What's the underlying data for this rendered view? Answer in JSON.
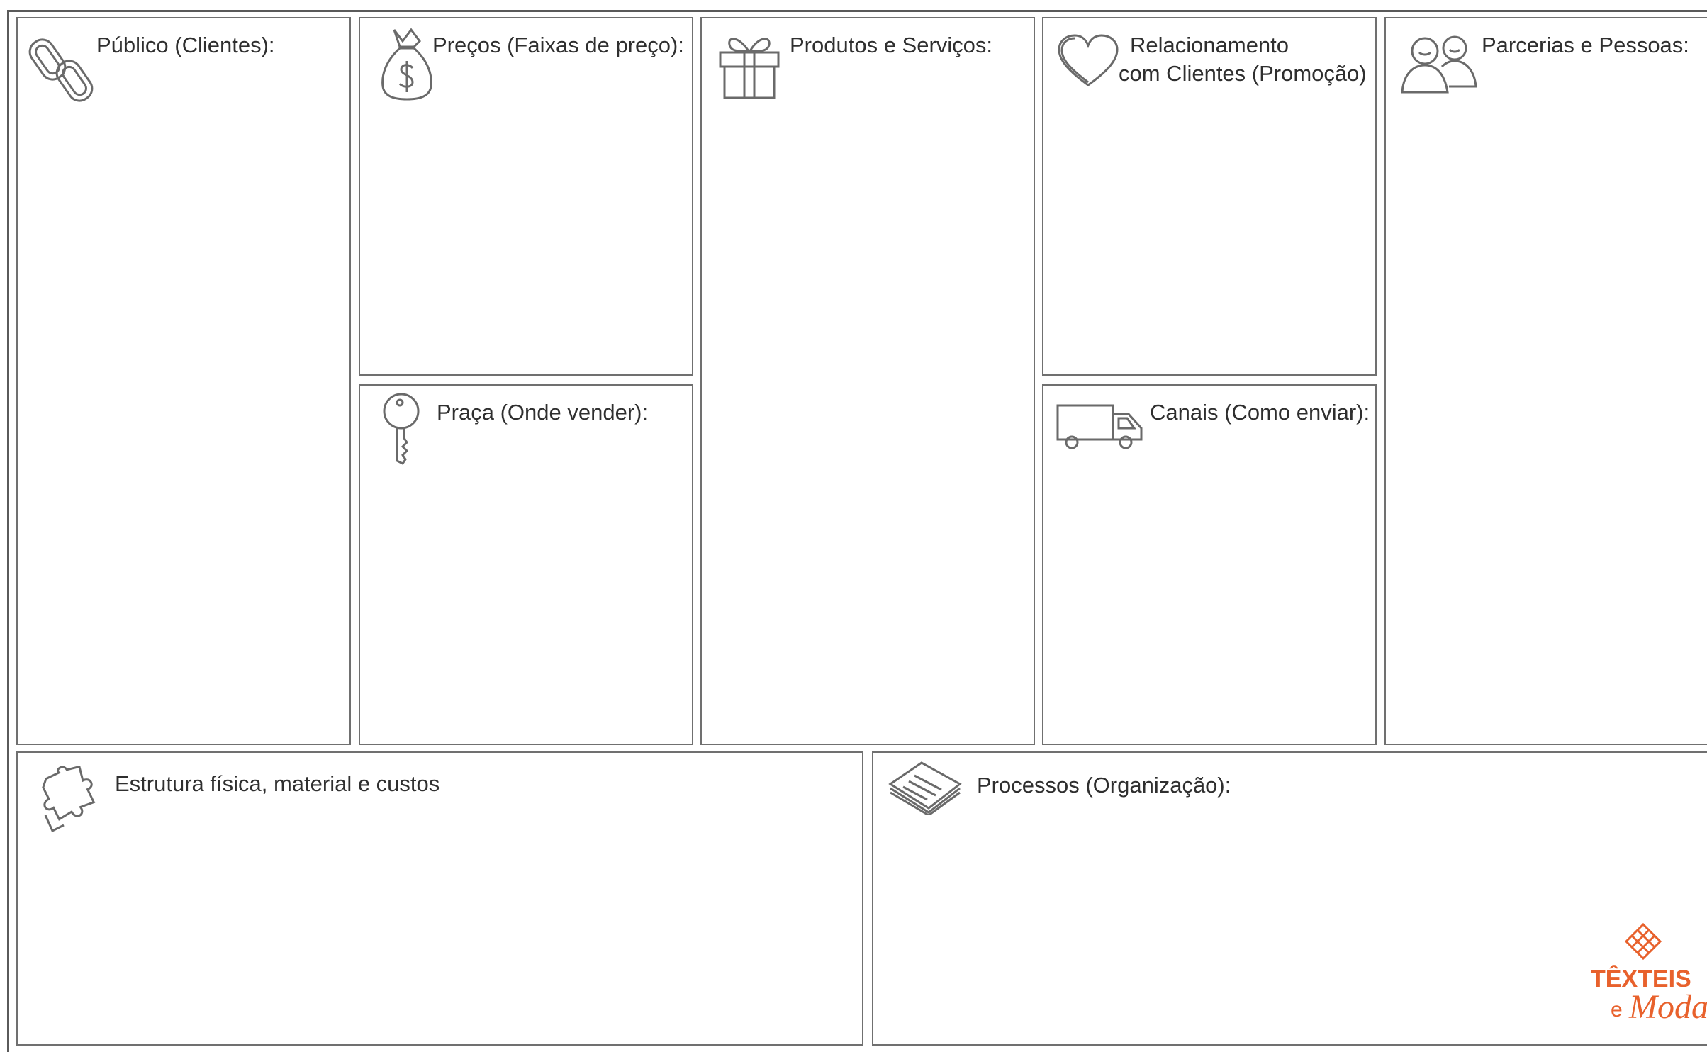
{
  "canvas": {
    "sections": {
      "publico": {
        "title": "Público (Clientes):",
        "icon": "chain-link-icon"
      },
      "precos": {
        "title": "Preços (Faixas de preço):",
        "icon": "money-bag-icon"
      },
      "praca": {
        "title": "Praça (Onde vender):",
        "icon": "key-icon"
      },
      "produtos": {
        "title": "Produtos e Serviços:",
        "icon": "gift-icon"
      },
      "relacionamento": {
        "title_line1": "Relacionamento",
        "title_line2": "com Clientes (Promoção)",
        "icon": "heart-icon"
      },
      "canais": {
        "title": "Canais (Como enviar):",
        "icon": "truck-icon"
      },
      "parcerias": {
        "title": "Parcerias e Pessoas:",
        "icon": "people-icon"
      },
      "estrutura": {
        "title": "Estrutura física, material e custos",
        "icon": "puzzle-piece-icon"
      },
      "processos": {
        "title": "Processos (Organização):",
        "icon": "papers-icon"
      }
    }
  },
  "logo": {
    "line1": "TÊXTEIS",
    "line2_prefix": "e",
    "line2_script": "Moda",
    "color": "#e8612c"
  },
  "colors": {
    "border": "#707070",
    "text": "#2f2f2f",
    "icon_stroke": "#6a6a6a",
    "accent": "#e8612c"
  }
}
